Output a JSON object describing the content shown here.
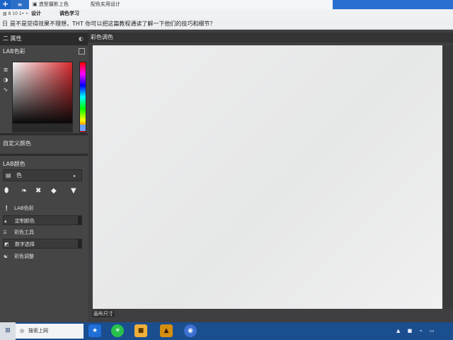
{
  "titlebar": {
    "app_glyph": "+",
    "active_tab_glyph": "≡",
    "tab_1": "▣ 造型摄影上色",
    "tab_2": "配色实用设计"
  },
  "toolbar": {
    "small_icon": "▧ 8 10 1• •",
    "status_1": "设计",
    "status_2": "调色学习"
  },
  "notice": {
    "icon": "日",
    "text": "是不是觉得效果不理想，THT 你可以把这篇教程通读了解一下他们的技巧和细节？"
  },
  "left_panel": {
    "top_header": {
      "label": "二 属性",
      "icon": "◐"
    },
    "color_header": {
      "label": "LAB色彩"
    },
    "color_tools": [
      "≣",
      "◑",
      "∿"
    ],
    "section_1": "自定义颜色",
    "section_2": "LAB颜色",
    "dropdown": {
      "icon": "▤",
      "label": "色",
      "arrow": "▸"
    },
    "shapes": [
      "⬮",
      "❧",
      "✖",
      "◆",
      "▼"
    ],
    "rows": [
      {
        "icon": "❕",
        "label": "LAB色彩",
        "boxed": false
      },
      {
        "icon": "▴",
        "label": "定制颜色",
        "boxed": true
      },
      {
        "icon": "⌹",
        "label": "彩色工具",
        "boxed": false
      },
      {
        "icon": "◩",
        "label": "数字选择",
        "boxed": true
      },
      {
        "icon": "☯",
        "label": "彩色调整",
        "boxed": false
      }
    ]
  },
  "canvas": {
    "header": "彩色调色",
    "status": "画布尺寸"
  },
  "taskbar": {
    "start_glyph": "⊞",
    "search_icon": "◎",
    "search_text": "搜索上网",
    "apps": [
      "★",
      "☀",
      "■",
      "▲",
      "◉"
    ],
    "tray": [
      "▲",
      "■",
      "⌁",
      "▭"
    ]
  }
}
